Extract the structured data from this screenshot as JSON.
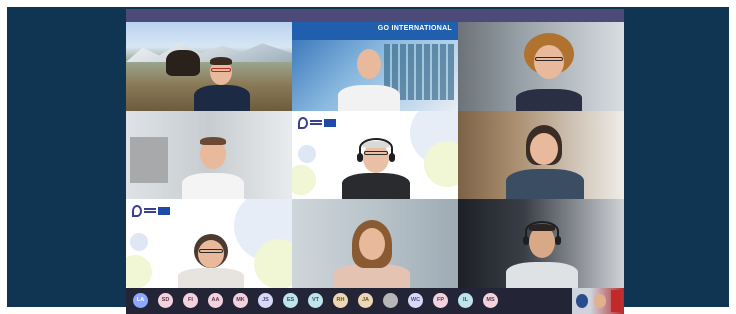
{
  "meeting": {
    "poster_title": "GO INTERNATIONAL"
  },
  "participants_bar": {
    "avatars": [
      {
        "initials": "LA",
        "style": "blue"
      },
      {
        "initials": "SD",
        "style": "pink"
      },
      {
        "initials": "FI",
        "style": "pink"
      },
      {
        "initials": "AA",
        "style": "pink"
      },
      {
        "initials": "MK",
        "style": "pink"
      },
      {
        "initials": "JS",
        "style": "lav"
      },
      {
        "initials": "ES",
        "style": "teal"
      },
      {
        "initials": "VT",
        "style": "teal"
      },
      {
        "initials": "RH",
        "style": "sand"
      },
      {
        "initials": "JA",
        "style": "sand"
      },
      {
        "initials": "",
        "style": "grey"
      },
      {
        "initials": "WC",
        "style": "lav"
      },
      {
        "initials": "FP",
        "style": "pink"
      },
      {
        "initials": "IL",
        "style": "teal"
      },
      {
        "initials": "MS",
        "style": "pink"
      }
    ]
  },
  "colors": {
    "background_frame": "#0f3552",
    "top_bar": "#4b4a78",
    "participant_bar": "#232536"
  }
}
